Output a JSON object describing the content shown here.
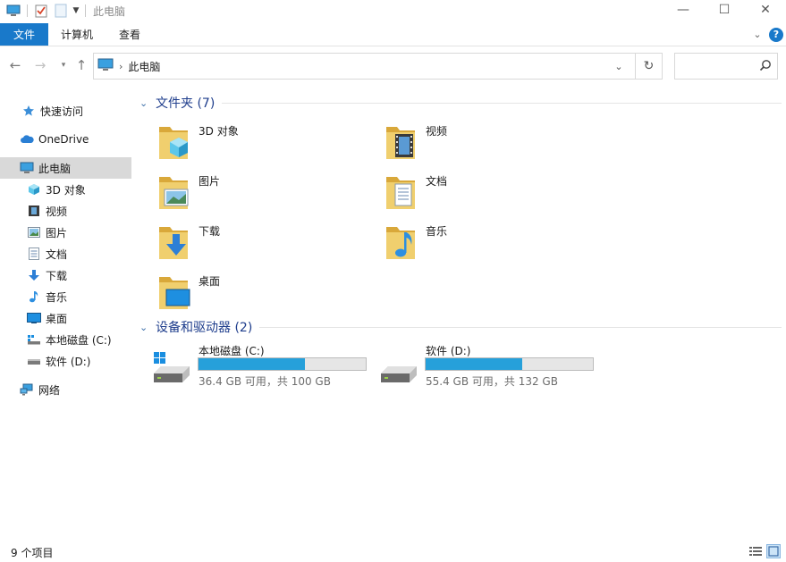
{
  "window": {
    "title": "此电脑",
    "controls": {
      "minimize": "—",
      "maximize": "☐",
      "close": "✕"
    }
  },
  "ribbon": {
    "tabs": [
      {
        "label": "文件"
      },
      {
        "label": "计算机"
      },
      {
        "label": "查看"
      }
    ],
    "help": "?"
  },
  "nav": {
    "breadcrumb": [
      "此电脑"
    ],
    "search_placeholder": ""
  },
  "sidebar": {
    "items": [
      {
        "label": "快速访问",
        "icon": "star-icon"
      },
      {
        "label": "OneDrive",
        "icon": "cloud-icon"
      },
      {
        "label": "此电脑",
        "icon": "computer-icon",
        "selected": true
      },
      {
        "label": "3D 对象",
        "icon": "cube-icon"
      },
      {
        "label": "视频",
        "icon": "film-icon"
      },
      {
        "label": "图片",
        "icon": "picture-icon"
      },
      {
        "label": "文档",
        "icon": "document-icon"
      },
      {
        "label": "下载",
        "icon": "download-icon"
      },
      {
        "label": "音乐",
        "icon": "music-icon"
      },
      {
        "label": "桌面",
        "icon": "desktop-icon"
      },
      {
        "label": "本地磁盘 (C:)",
        "icon": "drive-icon"
      },
      {
        "label": "软件 (D:)",
        "icon": "drive-icon"
      },
      {
        "label": "网络",
        "icon": "network-icon"
      }
    ]
  },
  "main": {
    "folders_header": "文件夹 (7)",
    "folders": [
      {
        "label": "3D 对象",
        "icon": "cube-icon"
      },
      {
        "label": "视频",
        "icon": "film-icon"
      },
      {
        "label": "图片",
        "icon": "picture-icon"
      },
      {
        "label": "文档",
        "icon": "document-icon"
      },
      {
        "label": "下载",
        "icon": "download-icon"
      },
      {
        "label": "音乐",
        "icon": "music-icon"
      },
      {
        "label": "桌面",
        "icon": "desktop-icon"
      }
    ],
    "devices_header": "设备和驱动器 (2)",
    "drives": [
      {
        "name": "本地磁盘 (C:)",
        "free_text": "36.4 GB 可用，共 100 GB",
        "used_fraction": 0.636,
        "windows": true
      },
      {
        "name": "软件 (D:)",
        "free_text": "55.4 GB 可用，共 132 GB",
        "used_fraction": 0.58,
        "windows": false
      }
    ]
  },
  "status": {
    "item_count": "9 个项目"
  },
  "colors": {
    "accent": "#1979ca",
    "header_text": "#1e3d8c",
    "drive_bar": "#26a0da",
    "folder": "#e8c15c",
    "selected_bg": "#d9d9d9"
  }
}
